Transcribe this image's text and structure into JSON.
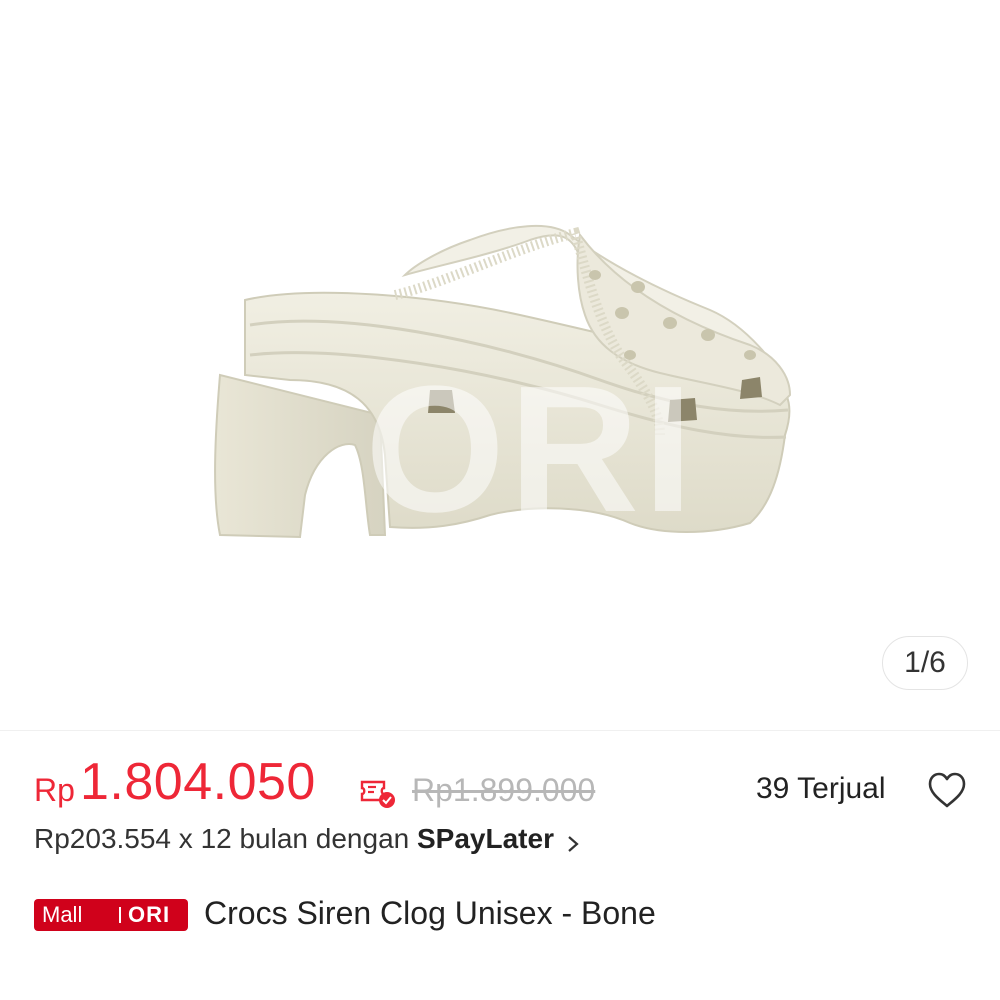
{
  "gallery": {
    "image_alt": "Crocs Siren Clog Unisex - Bone",
    "watermark": "ORI",
    "page_indicator": "1/6"
  },
  "price": {
    "currency": "Rp",
    "amount": "1.804.050",
    "original": "Rp1.899.000",
    "sold": "39 Terjual"
  },
  "installment": {
    "text": "Rp203.554 x 12 bulan dengan ",
    "brand": "SPayLater"
  },
  "badge": {
    "mall": "Mall",
    "ori": "ORI"
  },
  "product": {
    "title": "Crocs Siren Clog Unisex - Bone"
  },
  "icons": {
    "voucher": "voucher-icon",
    "wishlist": "heart-outline-icon",
    "chevron": "chevron-right-icon"
  },
  "colors": {
    "price": "#ee2737",
    "badge": "#d0011b",
    "shoe": "#ebe8d9"
  }
}
